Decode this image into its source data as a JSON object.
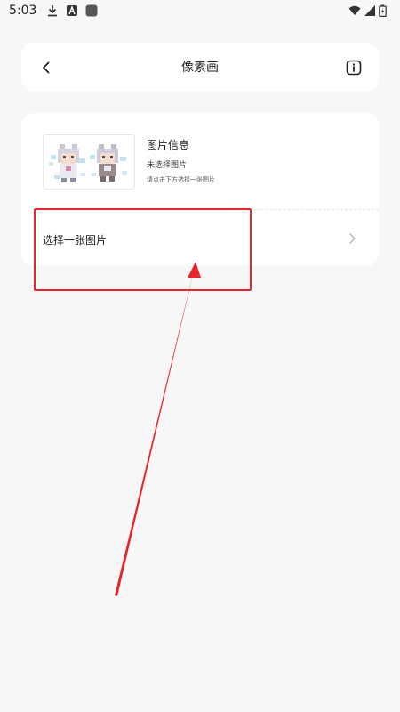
{
  "status_bar": {
    "time": "5:03",
    "icons": [
      "download-icon",
      "a-badge-icon",
      "app-icon",
      "wifi-icon",
      "signal-icon",
      "battery-icon"
    ]
  },
  "header": {
    "title": "像素画",
    "back_icon": "back-chevron-icon",
    "info_icon": "info-icon"
  },
  "image_info": {
    "title": "图片信息",
    "status": "未选择图片",
    "hint": "请点击下方选择一张图片"
  },
  "select_row": {
    "label": "选择一张图片",
    "chevron_icon": "chevron-right-icon"
  },
  "colors": {
    "background": "#f7f7f7",
    "card": "#ffffff",
    "annotation": "#e8262a"
  }
}
